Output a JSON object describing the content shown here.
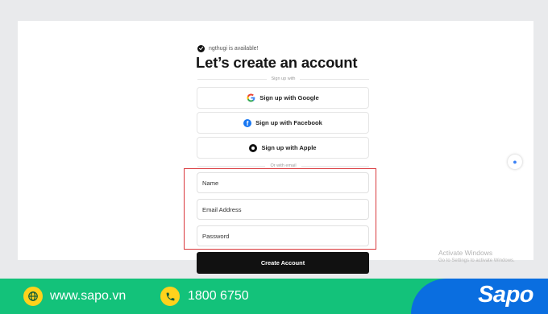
{
  "form": {
    "availability_text": "ngthugi is available!",
    "title": "Let’s create an account",
    "signup_with_label": "Sign up with",
    "social_buttons": {
      "google": "Sign up with Google",
      "facebook": "Sign up with Facebook",
      "apple": "Sign up with Apple"
    },
    "or_with_email_label": "Or with email",
    "fields": {
      "name_placeholder": "Name",
      "email_placeholder": "Email Address",
      "password_placeholder": "Password"
    },
    "create_button": "Create Account"
  },
  "watermark": {
    "line1": "Activate Windows",
    "line2": "Go to Settings to activate Windows."
  },
  "footer": {
    "website": "www.sapo.vn",
    "phone": "1800 6750",
    "logo": "Sapo"
  },
  "colors": {
    "highlight": "#d9383c",
    "footer_green": "#13c27a",
    "footer_blue": "#0a6ee0",
    "icon_yellow": "#ffd21c",
    "facebook_blue": "#1877f2"
  }
}
